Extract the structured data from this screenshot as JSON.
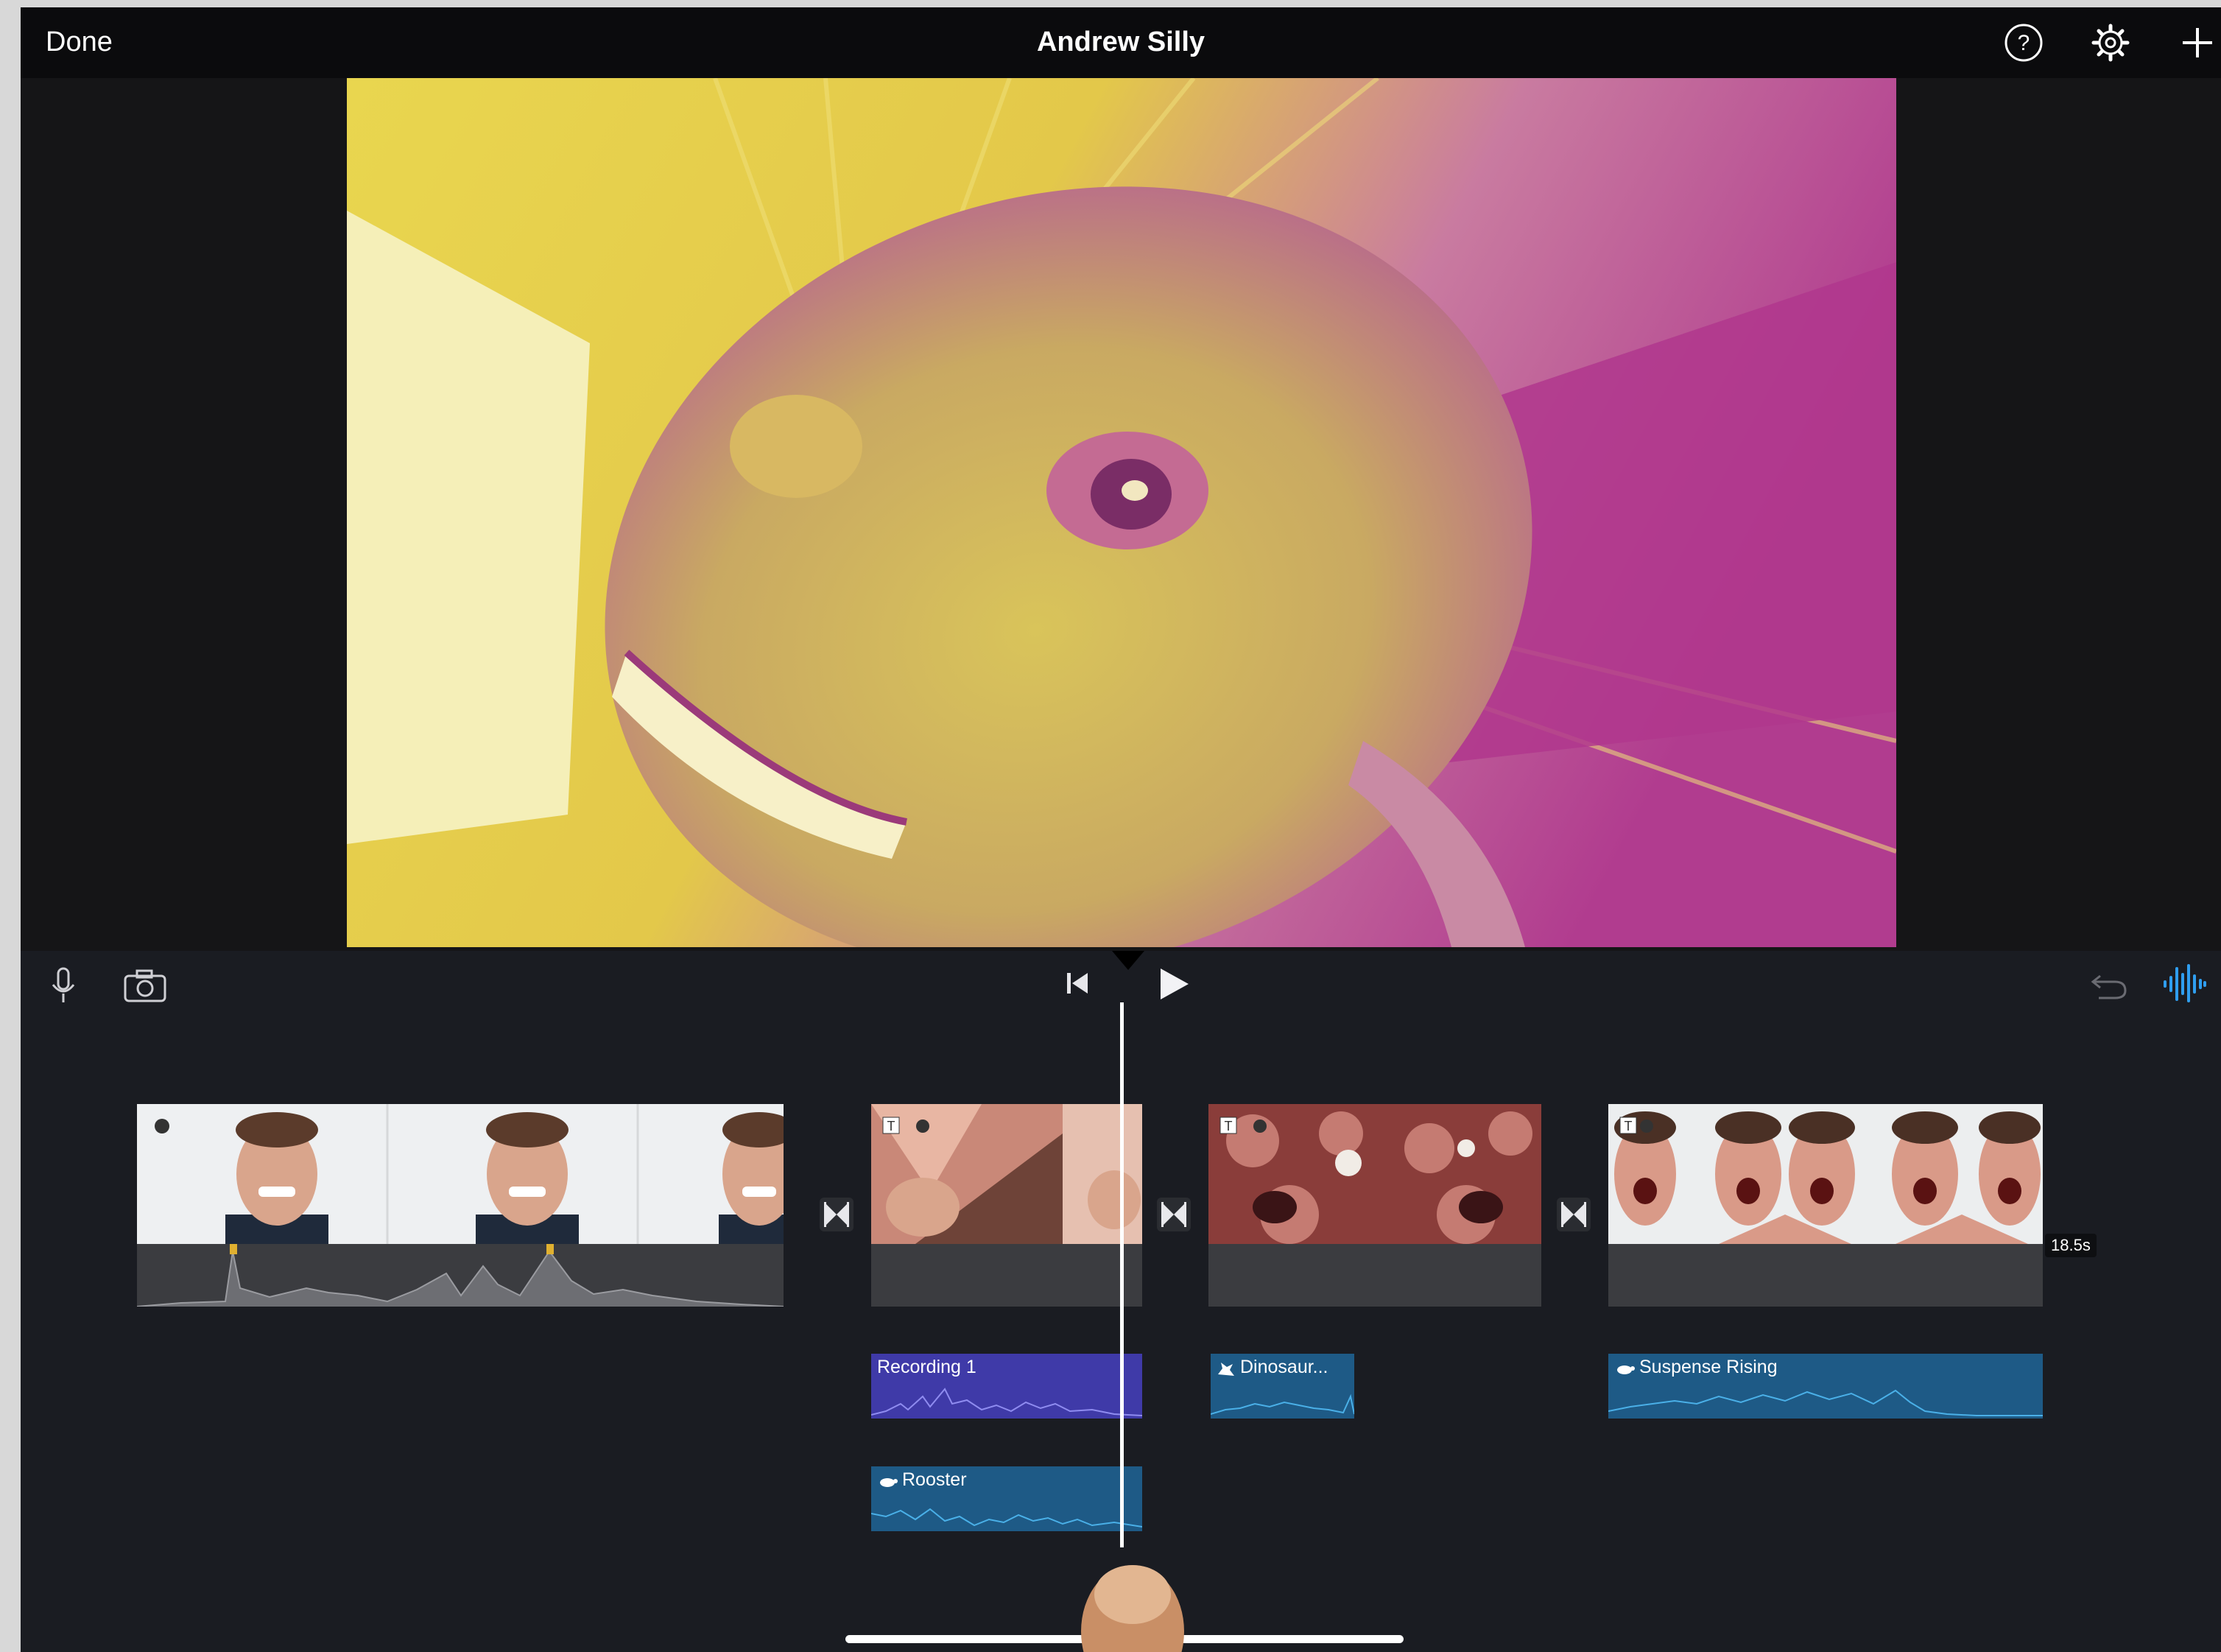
{
  "topbar": {
    "done_label": "Done",
    "project_title": "Andrew Silly",
    "icons": [
      "help-icon",
      "settings-gear-icon",
      "plus-icon"
    ]
  },
  "preview": {
    "description_colors": [
      "#e8d24a",
      "#b8428e",
      "#f4ecb0"
    ]
  },
  "toolbar": {
    "left_icons": [
      "microphone-icon",
      "camera-icon"
    ],
    "center_icons": [
      "skip-to-start-icon",
      "play-icon"
    ],
    "right_icons": [
      "undo-icon",
      "audio-waveform-icon"
    ],
    "accent_color": "#2f9ef0"
  },
  "timeline": {
    "duration_badge": "18.5s",
    "audio_clips": [
      {
        "label": "Recording 1",
        "color": "#3f3aa8"
      },
      {
        "label": "Dinosaur...",
        "color": "#1e5a86"
      },
      {
        "label": "Suspense Rising",
        "color": "#1e5a86"
      },
      {
        "label": "Rooster",
        "color": "#1e5a86"
      }
    ]
  }
}
